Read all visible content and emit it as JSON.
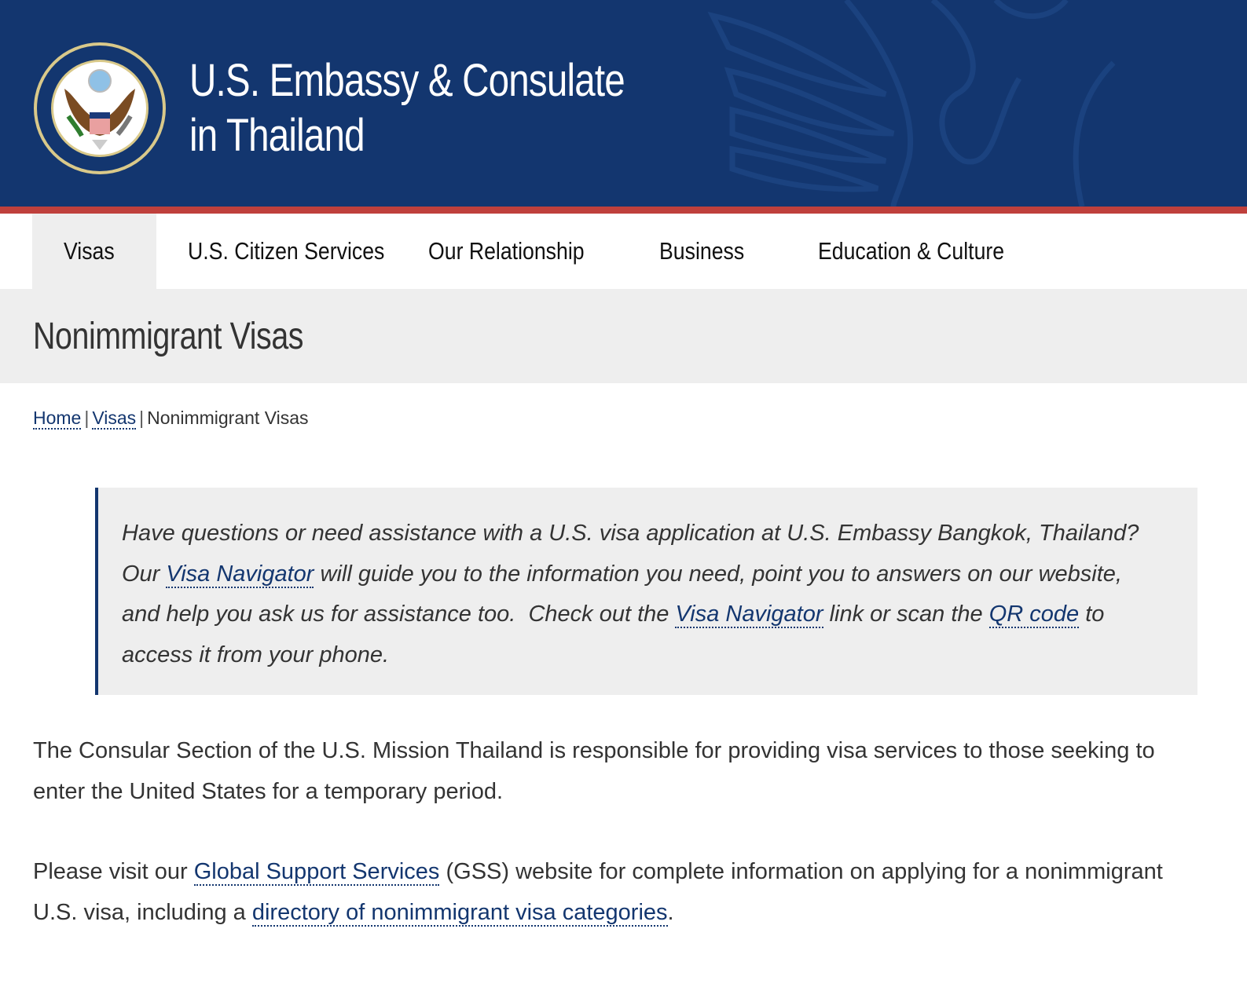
{
  "header": {
    "seal_icon": "department-of-state-seal-icon",
    "title_line1": "U.S. Embassy & Consulate",
    "title_line2": "in Thailand",
    "colors": {
      "header_bg": "#13366f",
      "accent_bar": "#bf403c"
    }
  },
  "nav": {
    "items": [
      {
        "label": "Visas",
        "active": true
      },
      {
        "label": "U.S. Citizen Services",
        "active": false
      },
      {
        "label": "Our Relationship",
        "active": false
      },
      {
        "label": "Business",
        "active": false
      },
      {
        "label": "Education & Culture",
        "active": false
      }
    ]
  },
  "page": {
    "title": "Nonimmigrant Visas"
  },
  "breadcrumb": {
    "items": [
      {
        "label": "Home",
        "link": true
      },
      {
        "label": "Visas",
        "link": true
      },
      {
        "label": "Nonimmigrant Visas",
        "link": false
      }
    ],
    "separator": "|"
  },
  "callout": {
    "t1": "Have questions or need assistance with a U.S. visa application at U.S. Embassy Bangkok, Thailand? Our ",
    "link1": "Visa Navigator",
    "t2": " will guide you to the information you need, point you to answers on our website, and help you ask us for assistance too.  Check out the ",
    "link2": "Visa Navigator",
    "t3": " link or scan the ",
    "link3": "QR code",
    "t4": " to access it from your phone."
  },
  "body": {
    "p1": "The Consular Section of the U.S. Mission Thailand is responsible for providing visa services to those seeking to enter the United States for a temporary period.",
    "p2_t1": "Please visit our ",
    "p2_link1": "Global Support Services",
    "p2_t2": " (GSS) website for complete information on applying for a nonimmigrant U.S. visa, including a ",
    "p2_link2": "directory of nonimmigrant visa categories",
    "p2_t3": "."
  },
  "colors": {
    "link": "#13366f",
    "text": "#333333",
    "band_bg": "#eeeeee"
  }
}
